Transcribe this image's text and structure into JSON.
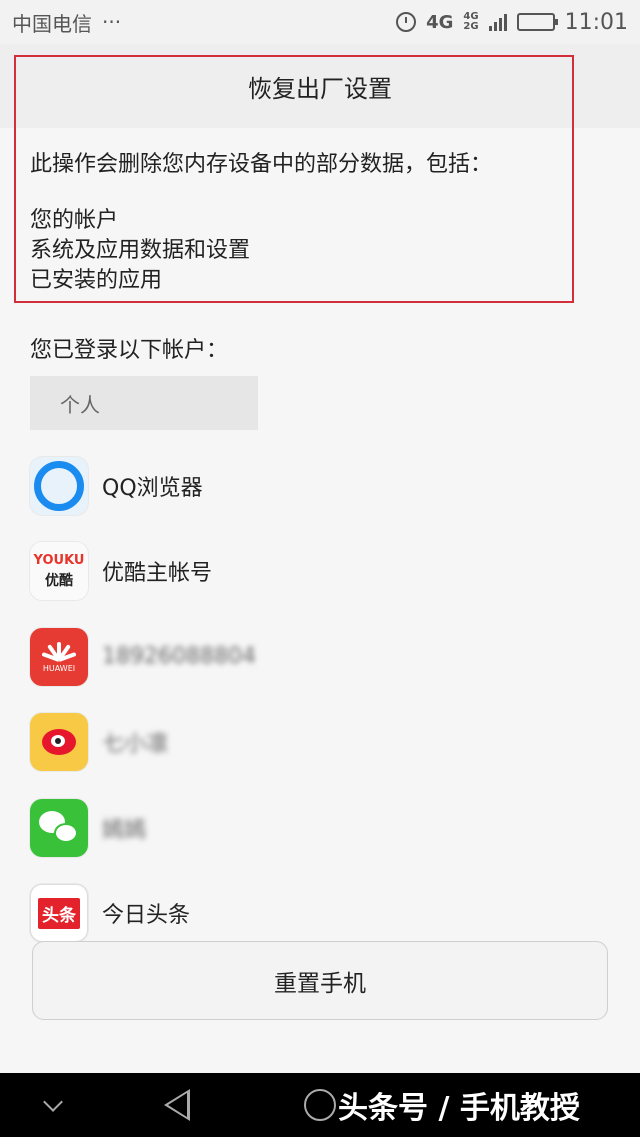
{
  "status_bar": {
    "carrier": "中国电信",
    "more": "···",
    "network_4g": "4G",
    "network_4g_small": "4G",
    "network_2g_small": "2G",
    "time": "11:01"
  },
  "dialog": {
    "title": "恢复出厂设置",
    "intro": "此操作会删除您内存设备中的部分数据，包括：",
    "items": [
      "您的帐户",
      "系统及应用数据和设置",
      "已安装的应用"
    ]
  },
  "accounts_section": {
    "label": "您已登录以下帐户：",
    "tab_label": "个人",
    "accounts": [
      {
        "icon": "qq-browser-icon",
        "name": "QQ浏览器"
      },
      {
        "icon": "youku-icon",
        "name": "优酷主帐号",
        "icon_text_top": "YOUKU",
        "icon_text_bottom": "优酷"
      },
      {
        "icon": "huawei-icon",
        "name": "18926088804",
        "icon_text": "HUAWEI"
      },
      {
        "icon": "weibo-icon",
        "name": "七小凛"
      },
      {
        "icon": "wechat-icon",
        "name": "嫣嫣"
      },
      {
        "icon": "toutiao-icon",
        "name": "今日头条",
        "icon_text": "头条"
      }
    ]
  },
  "reset_button_label": "重置手机",
  "nav_bar": {
    "watermark": "头条号 / 手机教授"
  },
  "colors": {
    "highlight_border": "#d32f3a",
    "background": "#f6f6f6"
  }
}
